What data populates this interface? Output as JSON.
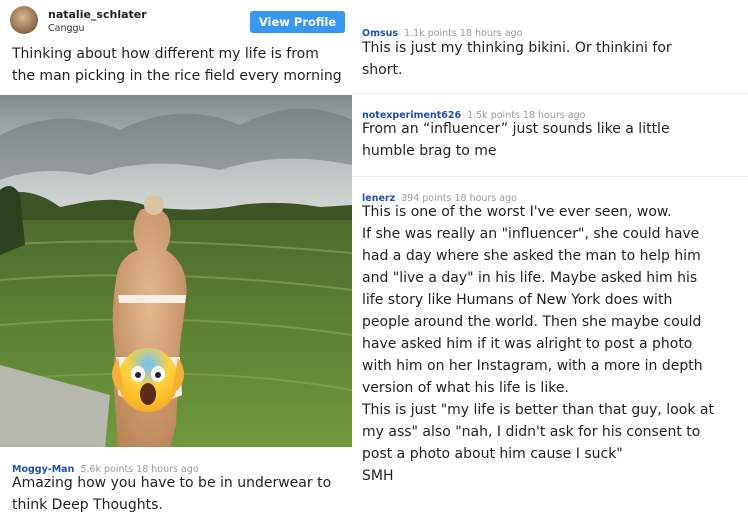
{
  "post": {
    "username": "natalie_schlater",
    "location": "Canggu",
    "view_profile_label": "View Profile",
    "caption": "Thinking about how different my life is from the man picking in the rice field every morning",
    "overlay_emoji": "😱"
  },
  "comments": [
    {
      "author": "Moggy-Man",
      "meta": "5.6k points 18 hours ago",
      "lines": [
        "Amazing how you have to be in underwear to",
        "think Deep Thoughts."
      ]
    },
    {
      "author": "Omsus",
      "meta": "1.1k points 18 hours ago",
      "lines": [
        "This is just my thinking bikini. Or thinkini for",
        "short."
      ]
    },
    {
      "author": "notexperiment626",
      "meta": "1.5k points 18 hours ago",
      "lines": [
        "From an “influencer” just sounds like a little",
        "humble brag to me"
      ]
    },
    {
      "author": "lenerz",
      "meta": "394 points 18 hours ago",
      "lines": [
        "This is one of the worst I've ever seen, wow.",
        "If she was really an \"influencer\", she could have",
        "had a day where she asked the man to help him",
        "and \"live a day\" in his life. Maybe asked him his",
        "life story like Humans of New York does with",
        "people around the world. Then she maybe could",
        "have asked him if it was alright to post a photo",
        "with him on her Instagram, with a more in depth",
        "version of what his life is like.",
        "This is just \"my life is better than that guy, look at",
        "my ass\" also \"nah, I didn't ask for his consent to",
        "post a photo about him cause I suck\"",
        "SMH"
      ]
    }
  ]
}
